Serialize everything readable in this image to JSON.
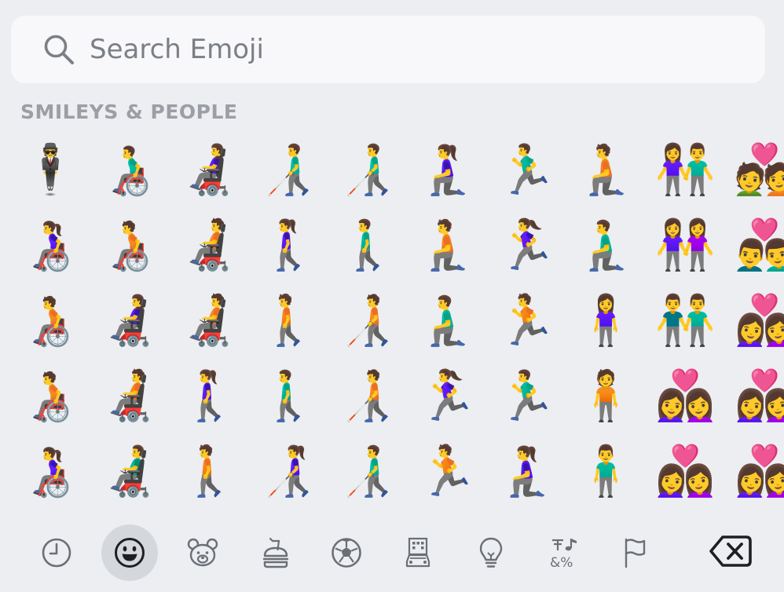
{
  "search": {
    "placeholder": "Search Emoji"
  },
  "section": {
    "title": "SMILEYS & PEOPLE"
  },
  "emoji_rows": [
    [
      "🕴️",
      "👨‍🦽",
      "👩‍🦼",
      "👨‍🦯",
      "👨‍🦯",
      "🧎‍♀️",
      "🏃‍♂️",
      "🧎",
      "👫",
      "💑"
    ],
    [
      "👩‍🦽",
      "🧑‍🦽",
      "🧑‍🦼",
      "🚶‍♀️",
      "🚶‍♂️",
      "🧎",
      "🏃‍♀️",
      "🧎‍♂️",
      "👭",
      "👨‍❤️‍👨"
    ],
    [
      "🧑‍🦽",
      "👩‍🦼",
      "🧑‍🦼",
      "🚶",
      "🧑‍🦯",
      "🧎‍♂️",
      "🏃",
      "🧍‍♀️",
      "👬",
      "👩‍❤️‍👩"
    ],
    [
      "🧑‍🦽",
      "🧑‍🦼",
      "🚶‍♀️",
      "🚶‍♂️",
      "🧑‍🦯",
      "🏃‍♀️",
      "🏃‍♂️",
      "🧍",
      "👩‍❤️‍👩",
      "👩‍❤️‍👩"
    ],
    [
      "👩‍🦽",
      "👨‍🦼",
      "🚶",
      "👩‍🦯",
      "👨‍🦯",
      "🏃",
      "🧎‍♀️",
      "🧍‍♂️",
      "👩‍❤️‍👩",
      "👩‍❤️‍👩"
    ]
  ],
  "categories": [
    {
      "id": "recent",
      "icon": "clock-icon",
      "selected": false
    },
    {
      "id": "smileys",
      "icon": "smiley-icon",
      "selected": true
    },
    {
      "id": "animals",
      "icon": "bear-icon",
      "selected": false
    },
    {
      "id": "food",
      "icon": "burger-drink-icon",
      "selected": false
    },
    {
      "id": "activity",
      "icon": "soccer-ball-icon",
      "selected": false
    },
    {
      "id": "travel",
      "icon": "building-car-icon",
      "selected": false
    },
    {
      "id": "objects",
      "icon": "lightbulb-icon",
      "selected": false
    },
    {
      "id": "symbols",
      "icon": "symbols-icon",
      "selected": false
    },
    {
      "id": "flags",
      "icon": "flag-icon",
      "selected": false
    }
  ],
  "delete_key": {
    "icon": "backspace-icon"
  },
  "colors": {
    "icon_stroke": "#6b6f76",
    "selected_bg": "#d4d7dc",
    "section_title": "#9b9ea4"
  }
}
